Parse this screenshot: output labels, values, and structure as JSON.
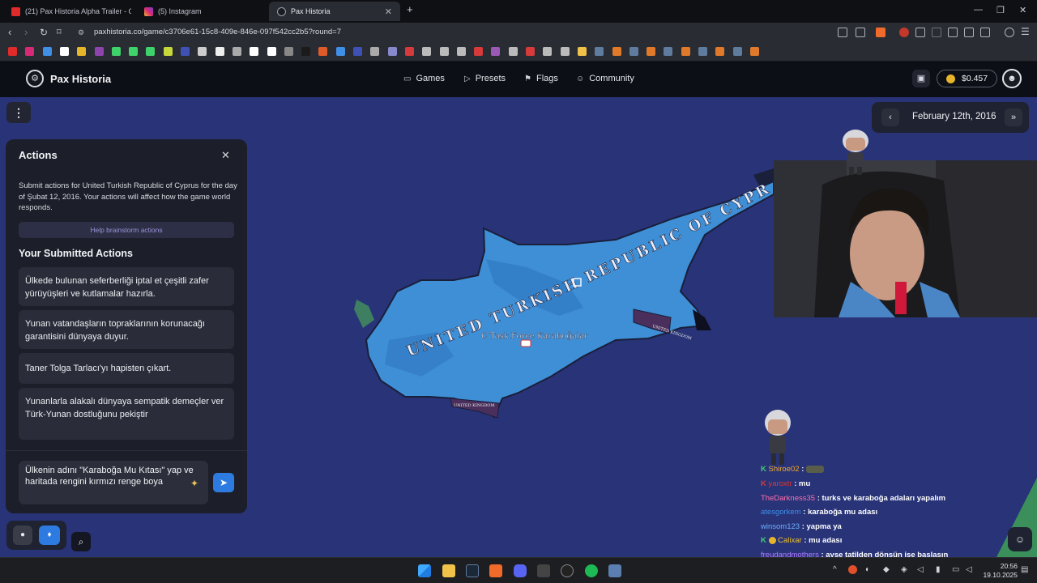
{
  "browser": {
    "tabs": [
      {
        "title": "(21) Pax Historia Alpha Trailer - Offici",
        "active": false
      },
      {
        "title": "(5) Instagram",
        "active": false
      },
      {
        "title": "Pax Historia",
        "active": true
      }
    ],
    "new_tab": "+",
    "url": "paxhistoria.co/game/c3706e61-15c8-409e-846e-097f542cc2b5?round=7"
  },
  "site": {
    "brand": "Pax Historia",
    "nav": [
      {
        "label": "Games",
        "icon": "gamepad-icon"
      },
      {
        "label": "Presets",
        "icon": "play-icon"
      },
      {
        "label": "Flags",
        "icon": "flag-icon"
      },
      {
        "label": "Community",
        "icon": "users-icon"
      }
    ],
    "balance": "$0.457"
  },
  "date_panel": {
    "prev": "‹",
    "date": "February 12th, 2016",
    "next": "»"
  },
  "actions_panel": {
    "title": "Actions",
    "close": "✕",
    "description": "Submit actions for United Turkish Republic of Cyprus for the day of Şubat 12, 2016. Your actions will affect how the game world responds.",
    "help_button": "Help brainstorm actions",
    "submitted_title": "Your Submitted Actions",
    "submitted": [
      "Ülkede bulunan seferberliği iptal et çeşitli zafer yürüyüşleri ve kutlamalar hazırla.",
      "Yunan vatandaşların topraklarının korunacağı garantisini dünyaya duyur.",
      "Taner Tolga Tarlacı'yı hapisten çıkart.",
      "Yunanlarla alakalı dünyaya sempatik demeçler ver Türk-Yunan dostluğunu pekiştir"
    ],
    "input_value": "Ülkenin adını \"Karaboğa Mu Kıtası\" yap ve haritada rengini kırmızı renge boya"
  },
  "map": {
    "country_label": "UNITED TURKISH REPUBLIC OF CYPRUS",
    "unit_label": "C Task Force Karaboğalar",
    "enclave_label": "UNITED KINGDOM",
    "enclave_label_2": "UNITED KINGDOM",
    "colors": {
      "sea": "#283378",
      "land": "#3f8fd6",
      "land_dark": "#2f6fb8",
      "border": "#1a1f3a",
      "enclave": "#4a2f5c"
    }
  },
  "chat": [
    {
      "user": "Shiroe02",
      "msg": "",
      "color": "#f0a62e",
      "badge": "K"
    },
    {
      "user": "yaroxtr",
      "msg": ": mu",
      "color": "#d63a3a",
      "badge": "K"
    },
    {
      "user": "TheDarkness35",
      "msg": ": turks ve karaboğa adaları yapalım",
      "color": "#ff6fa8",
      "badge": ""
    },
    {
      "user": "atesgorkem",
      "msg": ": karaboğa mu adası",
      "color": "#3f8fe6",
      "badge": ""
    },
    {
      "user": "winsom123",
      "msg": ": yapma ya",
      "color": "#6fb1ff",
      "badge": ""
    },
    {
      "user": "Calixar",
      "msg": ": mu adası",
      "color": "#f0c02e",
      "badge": "K"
    },
    {
      "user": "freudandmothers",
      "msg": ": ayşe tatilden dönsün işe başlasın",
      "color": "#b07cff",
      "badge": ""
    }
  ],
  "taskbar": {
    "time": "20:56",
    "date": "19.10.2025"
  }
}
